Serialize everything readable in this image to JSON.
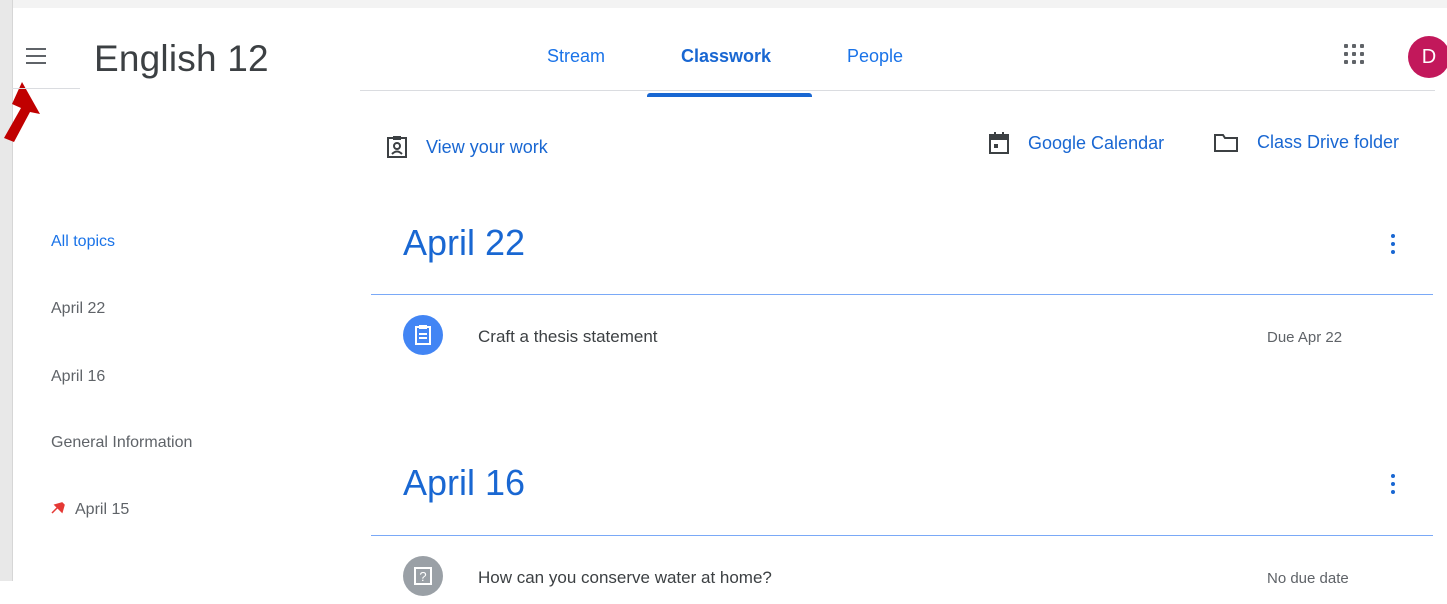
{
  "header": {
    "title": "English 12",
    "tabs": [
      "Stream",
      "Classwork",
      "People"
    ],
    "avatar_initial": "D"
  },
  "toolbar": {
    "view_work": "View your work",
    "google_calendar": "Google Calendar",
    "class_drive": "Class Drive folder"
  },
  "sidebar": {
    "items": [
      {
        "label": "All topics",
        "active": true
      },
      {
        "label": "April 22"
      },
      {
        "label": "April 16"
      },
      {
        "label": "General Information"
      },
      {
        "label": "April 15",
        "pinned": true
      }
    ]
  },
  "topics": [
    {
      "title": "April 22",
      "items": [
        {
          "title": "Craft a thesis statement",
          "due": "Due Apr 22",
          "icon": "assignment-icon"
        }
      ]
    },
    {
      "title": "April 16",
      "items": [
        {
          "title": "How can you conserve water at home?",
          "due": "No due date",
          "icon": "question-icon"
        }
      ]
    }
  ],
  "colors": {
    "accent": "#1967d2",
    "avatar": "#c2185b",
    "annotation_arrow": "#c00000"
  }
}
